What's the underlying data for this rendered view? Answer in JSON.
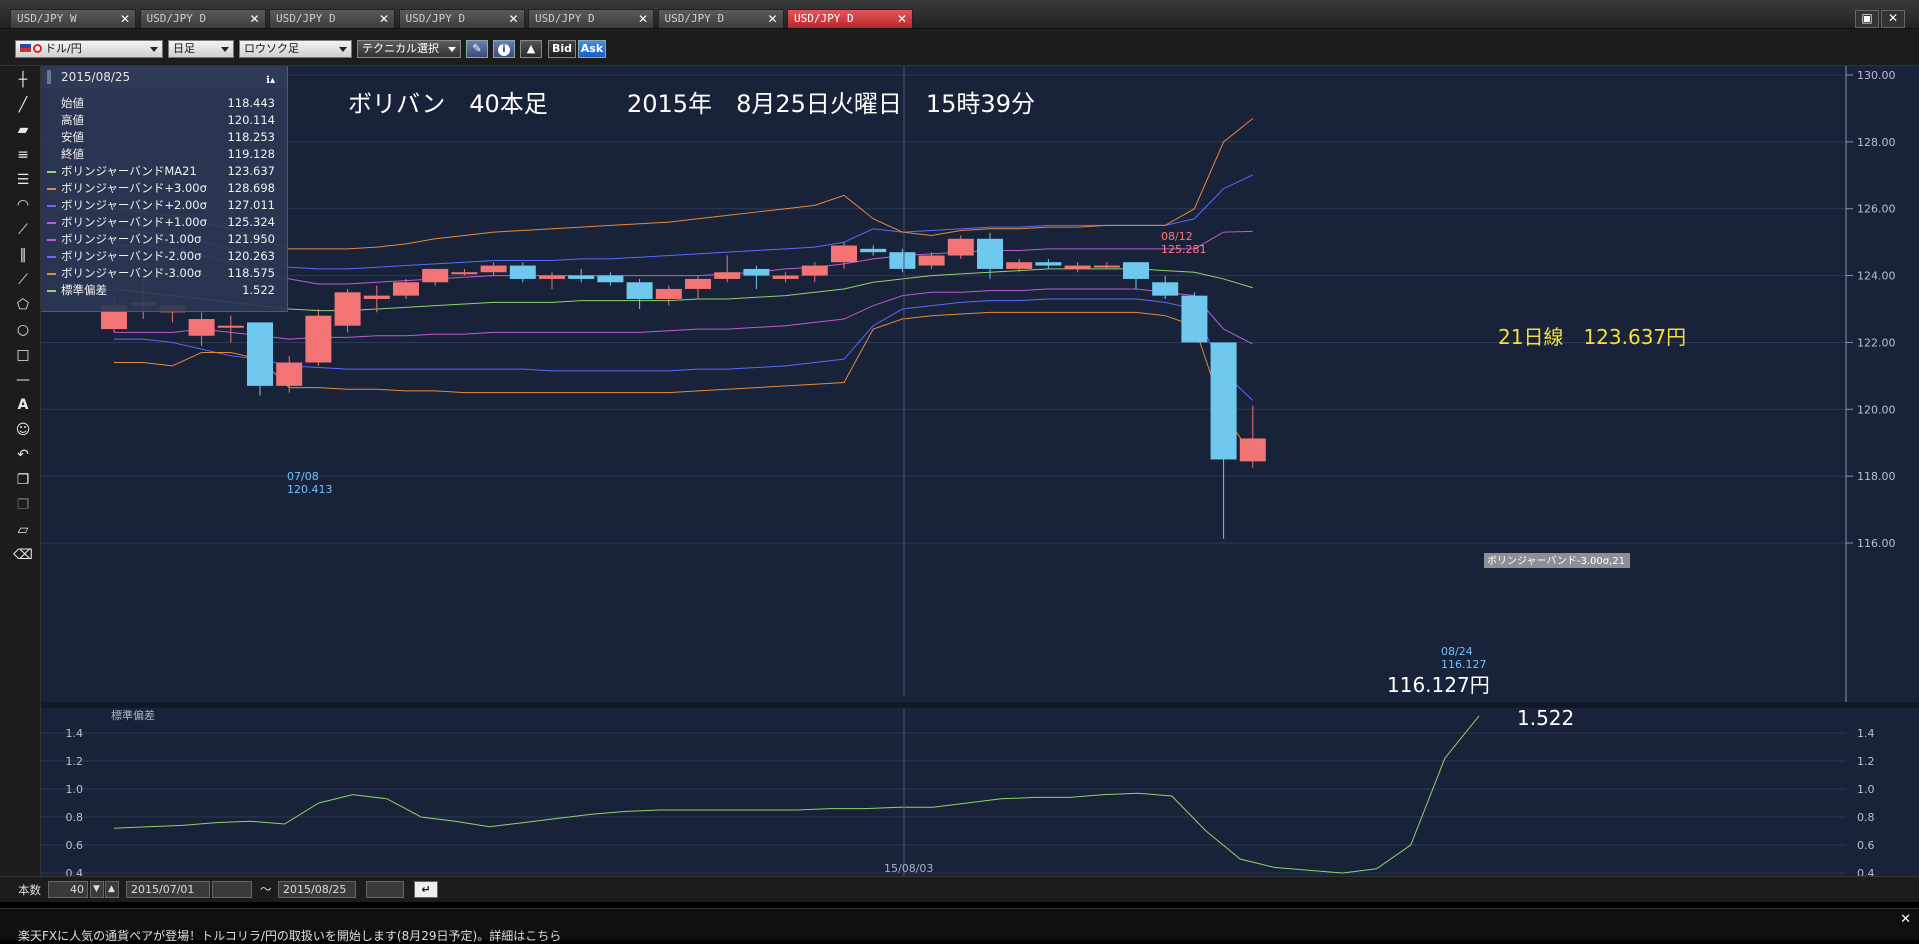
{
  "tabs": [
    {
      "label": "USD/JPY W",
      "active": false
    },
    {
      "label": "USD/JPY D",
      "active": false
    },
    {
      "label": "USD/JPY D",
      "active": false
    },
    {
      "label": "USD/JPY D",
      "active": false
    },
    {
      "label": "USD/JPY D",
      "active": false
    },
    {
      "label": "USD/JPY D",
      "active": false
    },
    {
      "label": "USD/JPY D",
      "active": true
    }
  ],
  "tab_close": "✕",
  "window_buttons": {
    "restore": "▣",
    "close": "✕"
  },
  "toolbar": {
    "pair": "ドル/円",
    "timeframe": "日足",
    "chart_type": "ロウソク足",
    "technical": "テクニカル選択",
    "bid": "Bid",
    "ask": "Ask"
  },
  "info_panel": {
    "date": "2015/08/25",
    "rows": [
      {
        "label": "始値",
        "value": "118.443",
        "color": ""
      },
      {
        "label": "高値",
        "value": "120.114",
        "color": ""
      },
      {
        "label": "安値",
        "value": "118.253",
        "color": ""
      },
      {
        "label": "終値",
        "value": "119.128",
        "color": ""
      },
      {
        "label": "ボリンジャーバンドMA21",
        "value": "123.637",
        "color": "#8fd46a"
      },
      {
        "label": "ボリンジャーバンド+3.00σ",
        "value": "128.698",
        "color": "#e58a3a"
      },
      {
        "label": "ボリンジャーバンド+2.00σ",
        "value": "127.011",
        "color": "#6a6aff"
      },
      {
        "label": "ボリンジャーバンド+1.00σ",
        "value": "125.324",
        "color": "#c05ad6"
      },
      {
        "label": "ボリンジャーバンド-1.00σ",
        "value": "121.950",
        "color": "#c05ad6"
      },
      {
        "label": "ボリンジャーバンド-2.00σ",
        "value": "120.263",
        "color": "#6a6aff"
      },
      {
        "label": "ボリンジャーバンド-3.00σ",
        "value": "118.575",
        "color": "#e58a3a"
      },
      {
        "label": "標準偏差",
        "value": "1.522",
        "color": "#8fd46a"
      }
    ]
  },
  "annotations": {
    "title_main": "ボリバン　40本足",
    "title_date": "2015年　8月25日火曜日　15時39分",
    "ma_label": "21日線　123.637円",
    "low_label": "116.127円",
    "std_label": "1.522",
    "high_marker_date": "08/12",
    "high_marker_value": "125.281",
    "low_marker1_date": "07/08",
    "low_marker1_value": "120.413",
    "low_marker2_date": "08/24",
    "low_marker2_value": "116.127",
    "band_tag": "ボリンジャーバンド-3.00σ,21",
    "subpanel_title": "標準偏差",
    "x_tick": "15/08/03"
  },
  "bottom": {
    "count_label": "本数",
    "count_value": "40",
    "from_date": "2015/07/01",
    "tilde": "～",
    "to_date": "2015/08/25"
  },
  "news": {
    "text": "楽天FXに人気の通貨ペアが登場！トルコリラ/円の取扱いを開始します(8月29日予定)。詳細はこちら",
    "close": "✕"
  },
  "chart_data": {
    "type": "candlestick",
    "y_ticks": [
      "130.00",
      "128.00",
      "126.00",
      "124.00",
      "122.00",
      "120.00",
      "118.00",
      "116.00"
    ],
    "ylim": [
      115.5,
      130.0
    ],
    "candles": [
      {
        "o": 122.4,
        "h": 123.4,
        "l": 122.3,
        "c": 123.1
      },
      {
        "o": 123.1,
        "h": 123.9,
        "l": 122.7,
        "c": 123.2
      },
      {
        "o": 122.9,
        "h": 123.1,
        "l": 122.6,
        "c": 123.1
      },
      {
        "o": 122.2,
        "h": 122.9,
        "l": 121.9,
        "c": 122.7
      },
      {
        "o": 122.5,
        "h": 122.8,
        "l": 122.0,
        "c": 122.5
      },
      {
        "o": 122.6,
        "h": 122.6,
        "l": 120.41,
        "c": 120.7
      },
      {
        "o": 120.7,
        "h": 121.6,
        "l": 120.5,
        "c": 121.4
      },
      {
        "o": 121.4,
        "h": 123.0,
        "l": 121.3,
        "c": 122.8
      },
      {
        "o": 122.5,
        "h": 123.6,
        "l": 122.3,
        "c": 123.5
      },
      {
        "o": 123.3,
        "h": 123.7,
        "l": 122.9,
        "c": 123.4
      },
      {
        "o": 123.4,
        "h": 123.9,
        "l": 123.3,
        "c": 123.8
      },
      {
        "o": 123.8,
        "h": 124.2,
        "l": 123.7,
        "c": 124.2
      },
      {
        "o": 124.1,
        "h": 124.2,
        "l": 124.0,
        "c": 124.1
      },
      {
        "o": 124.1,
        "h": 124.4,
        "l": 124.0,
        "c": 124.3
      },
      {
        "o": 124.3,
        "h": 124.4,
        "l": 123.8,
        "c": 123.9
      },
      {
        "o": 123.9,
        "h": 124.1,
        "l": 123.6,
        "c": 124.0
      },
      {
        "o": 124.0,
        "h": 124.2,
        "l": 123.8,
        "c": 123.9
      },
      {
        "o": 124.0,
        "h": 124.1,
        "l": 123.7,
        "c": 123.8
      },
      {
        "o": 123.8,
        "h": 123.9,
        "l": 123.0,
        "c": 123.3
      },
      {
        "o": 123.3,
        "h": 123.7,
        "l": 123.1,
        "c": 123.6
      },
      {
        "o": 123.6,
        "h": 124.0,
        "l": 123.3,
        "c": 123.9
      },
      {
        "o": 123.9,
        "h": 124.6,
        "l": 123.8,
        "c": 124.1
      },
      {
        "o": 124.2,
        "h": 124.3,
        "l": 123.6,
        "c": 124.0
      },
      {
        "o": 123.9,
        "h": 124.1,
        "l": 123.8,
        "c": 124.0
      },
      {
        "o": 124.0,
        "h": 124.4,
        "l": 123.8,
        "c": 124.3
      },
      {
        "o": 124.4,
        "h": 125.0,
        "l": 124.2,
        "c": 124.9
      },
      {
        "o": 124.8,
        "h": 124.9,
        "l": 124.6,
        "c": 124.7
      },
      {
        "o": 124.7,
        "h": 124.8,
        "l": 124.1,
        "c": 124.2
      },
      {
        "o": 124.3,
        "h": 124.7,
        "l": 124.2,
        "c": 124.6
      },
      {
        "o": 124.6,
        "h": 125.2,
        "l": 124.5,
        "c": 125.1
      },
      {
        "o": 125.1,
        "h": 125.28,
        "l": 123.9,
        "c": 124.2
      },
      {
        "o": 124.2,
        "h": 124.5,
        "l": 124.1,
        "c": 124.4
      },
      {
        "o": 124.4,
        "h": 124.5,
        "l": 124.2,
        "c": 124.3
      },
      {
        "o": 124.2,
        "h": 124.4,
        "l": 124.1,
        "c": 124.3
      },
      {
        "o": 124.3,
        "h": 124.4,
        "l": 124.2,
        "c": 124.3
      },
      {
        "o": 124.4,
        "h": 124.4,
        "l": 123.6,
        "c": 123.9
      },
      {
        "o": 123.8,
        "h": 124.0,
        "l": 123.3,
        "c": 123.4
      },
      {
        "o": 123.4,
        "h": 123.5,
        "l": 122.0,
        "c": 122.0
      },
      {
        "o": 122.0,
        "h": 122.0,
        "l": 116.127,
        "c": 118.5
      },
      {
        "o": 118.443,
        "h": 120.114,
        "l": 118.253,
        "c": 119.128
      }
    ],
    "bands": {
      "ma21": [
        123.6,
        123.5,
        123.4,
        123.3,
        123.2,
        123.1,
        123.0,
        122.95,
        122.95,
        123.0,
        123.05,
        123.1,
        123.15,
        123.2,
        123.2,
        123.2,
        123.25,
        123.25,
        123.25,
        123.25,
        123.3,
        123.3,
        123.35,
        123.4,
        123.5,
        123.6,
        123.8,
        123.9,
        124.0,
        124.05,
        124.1,
        124.15,
        124.2,
        124.2,
        124.2,
        124.2,
        124.15,
        124.1,
        123.9,
        123.637
      ],
      "p1": [
        124.9,
        124.9,
        124.8,
        124.6,
        124.4,
        124.1,
        123.9,
        123.75,
        123.75,
        123.8,
        123.85,
        123.9,
        123.95,
        124.0,
        124.0,
        124.0,
        124.0,
        124.0,
        124.0,
        124.0,
        124.0,
        124.05,
        124.1,
        124.2,
        124.25,
        124.35,
        124.5,
        124.6,
        124.65,
        124.7,
        124.75,
        124.75,
        124.8,
        124.8,
        124.8,
        124.8,
        124.8,
        124.8,
        125.3,
        125.324
      ],
      "p2": [
        125.4,
        125.3,
        125.2,
        125.0,
        124.8,
        124.5,
        124.25,
        124.2,
        124.2,
        124.25,
        124.3,
        124.35,
        124.4,
        124.45,
        124.45,
        124.45,
        124.5,
        124.5,
        124.55,
        124.6,
        124.65,
        124.7,
        124.75,
        124.8,
        124.85,
        125.0,
        125.4,
        125.3,
        125.35,
        125.4,
        125.45,
        125.45,
        125.5,
        125.5,
        125.5,
        125.5,
        125.5,
        125.7,
        126.6,
        127.011
      ],
      "p3": [
        126.0,
        125.9,
        125.8,
        125.6,
        125.4,
        125.1,
        124.8,
        124.8,
        124.8,
        124.85,
        124.95,
        125.1,
        125.2,
        125.3,
        125.35,
        125.4,
        125.45,
        125.5,
        125.55,
        125.6,
        125.7,
        125.8,
        125.9,
        126.0,
        126.1,
        126.4,
        125.7,
        125.3,
        125.2,
        125.35,
        125.4,
        125.4,
        125.45,
        125.45,
        125.5,
        125.5,
        125.5,
        126.0,
        128.0,
        128.698
      ],
      "m1": [
        122.3,
        122.3,
        122.3,
        122.4,
        122.3,
        122.2,
        122.1,
        122.15,
        122.15,
        122.2,
        122.2,
        122.25,
        122.25,
        122.3,
        122.3,
        122.3,
        122.3,
        122.3,
        122.3,
        122.35,
        122.4,
        122.4,
        122.45,
        122.5,
        122.6,
        122.7,
        123.1,
        123.4,
        123.5,
        123.5,
        123.55,
        123.55,
        123.6,
        123.6,
        123.6,
        123.6,
        123.5,
        123.4,
        122.4,
        121.95
      ],
      "m2": [
        122.1,
        122.1,
        122.0,
        121.8,
        121.6,
        121.5,
        121.3,
        121.25,
        121.2,
        121.2,
        121.2,
        121.2,
        121.2,
        121.2,
        121.2,
        121.15,
        121.15,
        121.15,
        121.15,
        121.15,
        121.2,
        121.2,
        121.25,
        121.3,
        121.4,
        121.5,
        122.5,
        123.0,
        123.1,
        123.2,
        123.25,
        123.25,
        123.3,
        123.3,
        123.3,
        123.3,
        123.2,
        123.0,
        121.1,
        120.263
      ],
      "m3": [
        121.4,
        121.4,
        121.3,
        121.7,
        121.7,
        121.5,
        120.65,
        120.65,
        120.6,
        120.6,
        120.55,
        120.55,
        120.5,
        120.5,
        120.5,
        120.5,
        120.5,
        120.5,
        120.5,
        120.5,
        120.55,
        120.6,
        120.65,
        120.7,
        120.75,
        120.8,
        122.4,
        122.7,
        122.8,
        122.85,
        122.9,
        122.9,
        122.9,
        122.9,
        122.9,
        122.9,
        122.8,
        122.5,
        119.9,
        118.575
      ]
    },
    "std_ticks": [
      "1.4",
      "1.2",
      "1.0",
      "0.8",
      "0.6",
      "0.4"
    ],
    "std_ylim": [
      0.35,
      1.55
    ],
    "std_dev": [
      0.72,
      0.73,
      0.74,
      0.76,
      0.77,
      0.75,
      0.9,
      0.96,
      0.93,
      0.8,
      0.77,
      0.73,
      0.76,
      0.79,
      0.82,
      0.84,
      0.85,
      0.85,
      0.85,
      0.85,
      0.85,
      0.86,
      0.86,
      0.87,
      0.87,
      0.9,
      0.93,
      0.94,
      0.94,
      0.96,
      0.97,
      0.95,
      0.7,
      0.5,
      0.44,
      0.42,
      0.4,
      0.43,
      0.6,
      1.22,
      1.522
    ]
  }
}
